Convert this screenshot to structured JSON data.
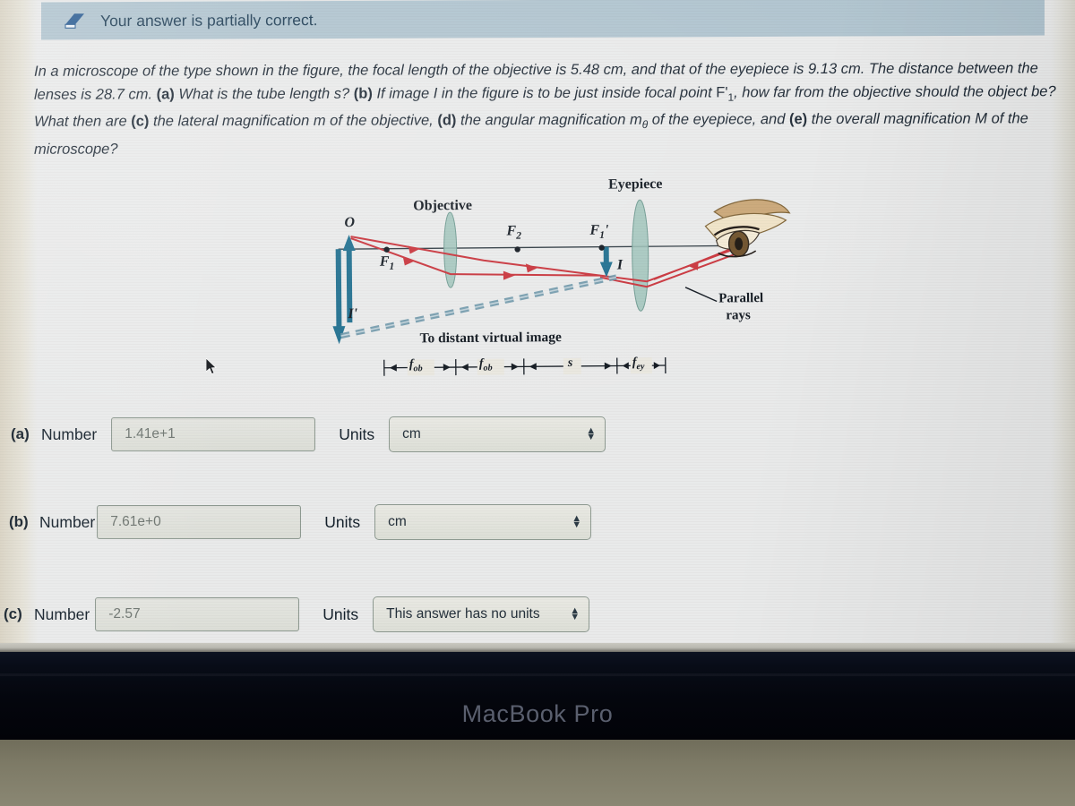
{
  "banner": {
    "icon": "eraser-icon",
    "message": "Your answer is partially correct.",
    "background_color": "#b0c4cf",
    "text_color": "#1d3c54"
  },
  "question": {
    "text": "In a microscope of the type shown in the figure, the focal length of the objective is 5.48 cm, and that of the eyepiece is 9.13 cm. The distance between the lenses is 28.7 cm. (a) What is the tube length s? (b) If image I in the figure is to be just inside focal point F'1, how far from the objective should the object be? What then are (c) the lateral magnification m of the objective, (d) the angular magnification me of the eyepiece, and (e) the overall magnification M of the microscope?",
    "objective_focal_length": "5.48 cm",
    "eyepiece_focal_length": "9.13 cm",
    "lens_separation": "28.7 cm"
  },
  "figure": {
    "title_objective": "Objective",
    "title_eyepiece": "Eyepiece",
    "label_O": "O",
    "label_F1": "F",
    "label_F1_sub": "1",
    "label_F2": "F",
    "label_F2_sub": "2",
    "label_F1prime": "F",
    "label_F1prime_sub": "1",
    "label_F1prime_prime": "'",
    "label_I": "I",
    "label_Iprime": "I'",
    "label_parallel_rays_line1": "Parallel",
    "label_parallel_rays_line2": "rays",
    "label_distant": "To distant virtual image",
    "scale_fob_1": "f",
    "scale_fob_1_sub": "ob",
    "scale_fob_2": "f",
    "scale_fob_2_sub": "ob",
    "scale_s": "s",
    "scale_fey": "f",
    "scale_fey_sub": "ey",
    "ray_color": "#c9333b",
    "lens_color": "#8fb8ae",
    "arrow_color": "#1f6f8f",
    "dashed_color": "#6b95a8",
    "eye_color": "#c9a676"
  },
  "answers": [
    {
      "letter": "(a)",
      "number_label": "Number",
      "value": "1.41e+1",
      "units_label": "Units",
      "unit_value": "cm"
    },
    {
      "letter": "(b)",
      "number_label": "Number",
      "value": "7.61e+0",
      "units_label": "Units",
      "unit_value": "cm"
    },
    {
      "letter": "(c)",
      "number_label": "Number",
      "value": "-2.57",
      "units_label": "Units",
      "unit_value": "This answer has no units"
    }
  ],
  "device": {
    "brand_label": "MacBook Pro"
  }
}
